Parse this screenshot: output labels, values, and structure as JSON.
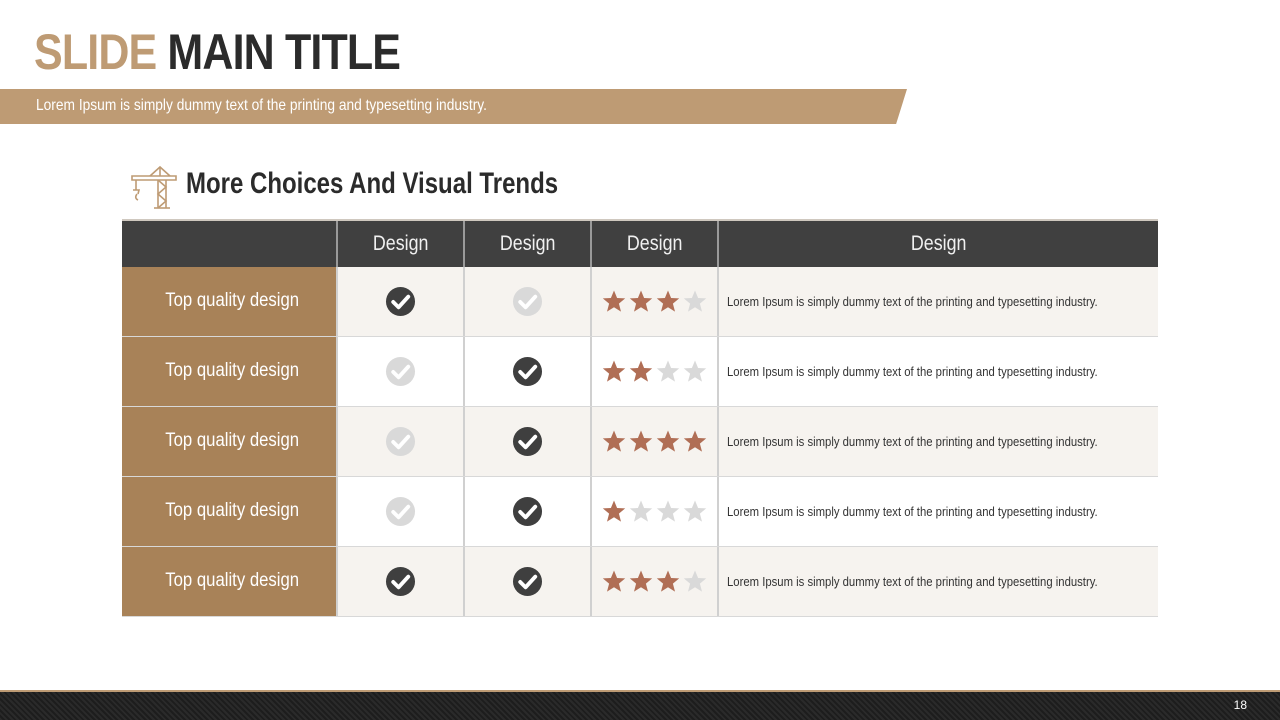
{
  "title": {
    "part1": "SLIDE",
    "part2": "MAIN TITLE"
  },
  "subtitle": "Lorem Ipsum is simply dummy text of the printing and typesetting industry.",
  "section": {
    "icon": "crane-icon",
    "heading": "More Choices And Visual Trends"
  },
  "table": {
    "headers": [
      "",
      "Design",
      "Design",
      "Design",
      "Design"
    ],
    "rows": [
      {
        "label": "Top quality design",
        "col1": "dark",
        "col2": "light",
        "rating": 3,
        "text": "Lorem Ipsum is simply dummy text of the printing and typesetting industry."
      },
      {
        "label": "Top quality design",
        "col1": "light",
        "col2": "dark",
        "rating": 2,
        "text": "Lorem Ipsum is simply dummy text of the printing and typesetting industry."
      },
      {
        "label": "Top quality design",
        "col1": "light",
        "col2": "dark",
        "rating": 4,
        "text": "Lorem Ipsum is simply dummy text of the printing and typesetting industry."
      },
      {
        "label": "Top quality design",
        "col1": "light",
        "col2": "dark",
        "rating": 1,
        "text": "Lorem Ipsum is simply dummy text of the printing and typesetting industry."
      },
      {
        "label": "Top quality design",
        "col1": "dark",
        "col2": "dark",
        "rating": 3,
        "text": "Lorem Ipsum is simply dummy text of the printing and typesetting industry."
      }
    ],
    "max_rating": 4
  },
  "colors": {
    "accent": "#be9b74",
    "row_label_bg": "#a88258",
    "header_bg": "#404040",
    "check_dark": "#3f3f3f",
    "check_light": "#d9d9d9",
    "star_filled": "#b06e55",
    "star_empty": "#d9d9d9"
  },
  "page_number": "18"
}
